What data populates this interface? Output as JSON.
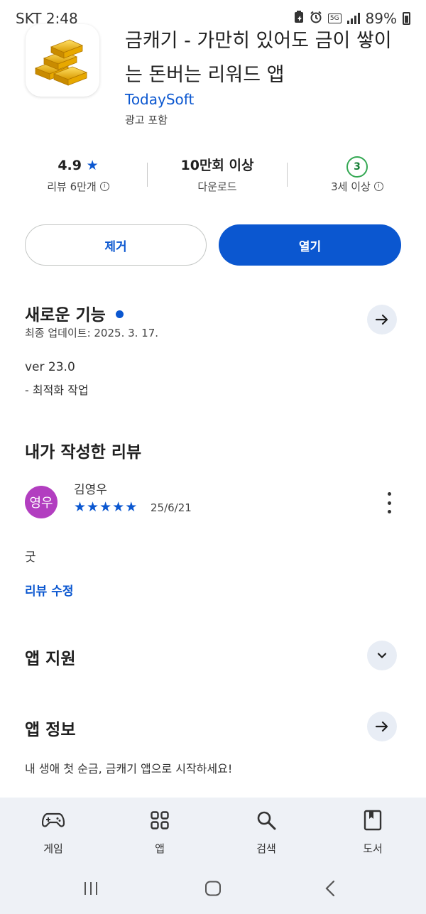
{
  "status_bar": {
    "carrier_time": "SKT 2:48",
    "network": "5G",
    "battery": "89%"
  },
  "app": {
    "title": "금캐기 - 가만히 있어도 금이 쌓이는 돈버는 리워드 앱",
    "developer": "TodaySoft",
    "ads_note": "광고 포함"
  },
  "stats": {
    "rating": "4.9",
    "rating_star": "★",
    "reviews_label": "리뷰 6만개",
    "downloads_value": "10만회 이상",
    "downloads_label": "다운로드",
    "age_value": "3",
    "age_label": "3세 이상",
    "info_glyph": "i"
  },
  "actions": {
    "uninstall": "제거",
    "open": "열기"
  },
  "whats_new": {
    "title": "새로운 기능",
    "updated": "최종 업데이트: 2025. 3. 17.",
    "version": "ver 23.0",
    "note": "- 최적화 작업"
  },
  "my_review": {
    "title": "내가 작성한 리뷰",
    "avatar_text": "영우",
    "avatar_color": "#b23ec0",
    "reviewer": "김영우",
    "rating": 5,
    "date": "25/6/21",
    "text": "굿",
    "edit_link": "리뷰 수정"
  },
  "app_support": {
    "title": "앱 지원"
  },
  "app_info": {
    "title": "앱 정보",
    "description": "내 생애 첫 순금, 금캐기 앱으로 시작하세요!"
  },
  "bottom_nav": [
    {
      "label": "게임",
      "icon": "gamepad-icon"
    },
    {
      "label": "앱",
      "icon": "apps-grid-icon"
    },
    {
      "label": "검색",
      "icon": "search-icon"
    },
    {
      "label": "도서",
      "icon": "book-icon"
    }
  ],
  "colors": {
    "accent": "#0b57d0",
    "age_badge": "#34a853",
    "nav_bg": "#eef1f6"
  }
}
